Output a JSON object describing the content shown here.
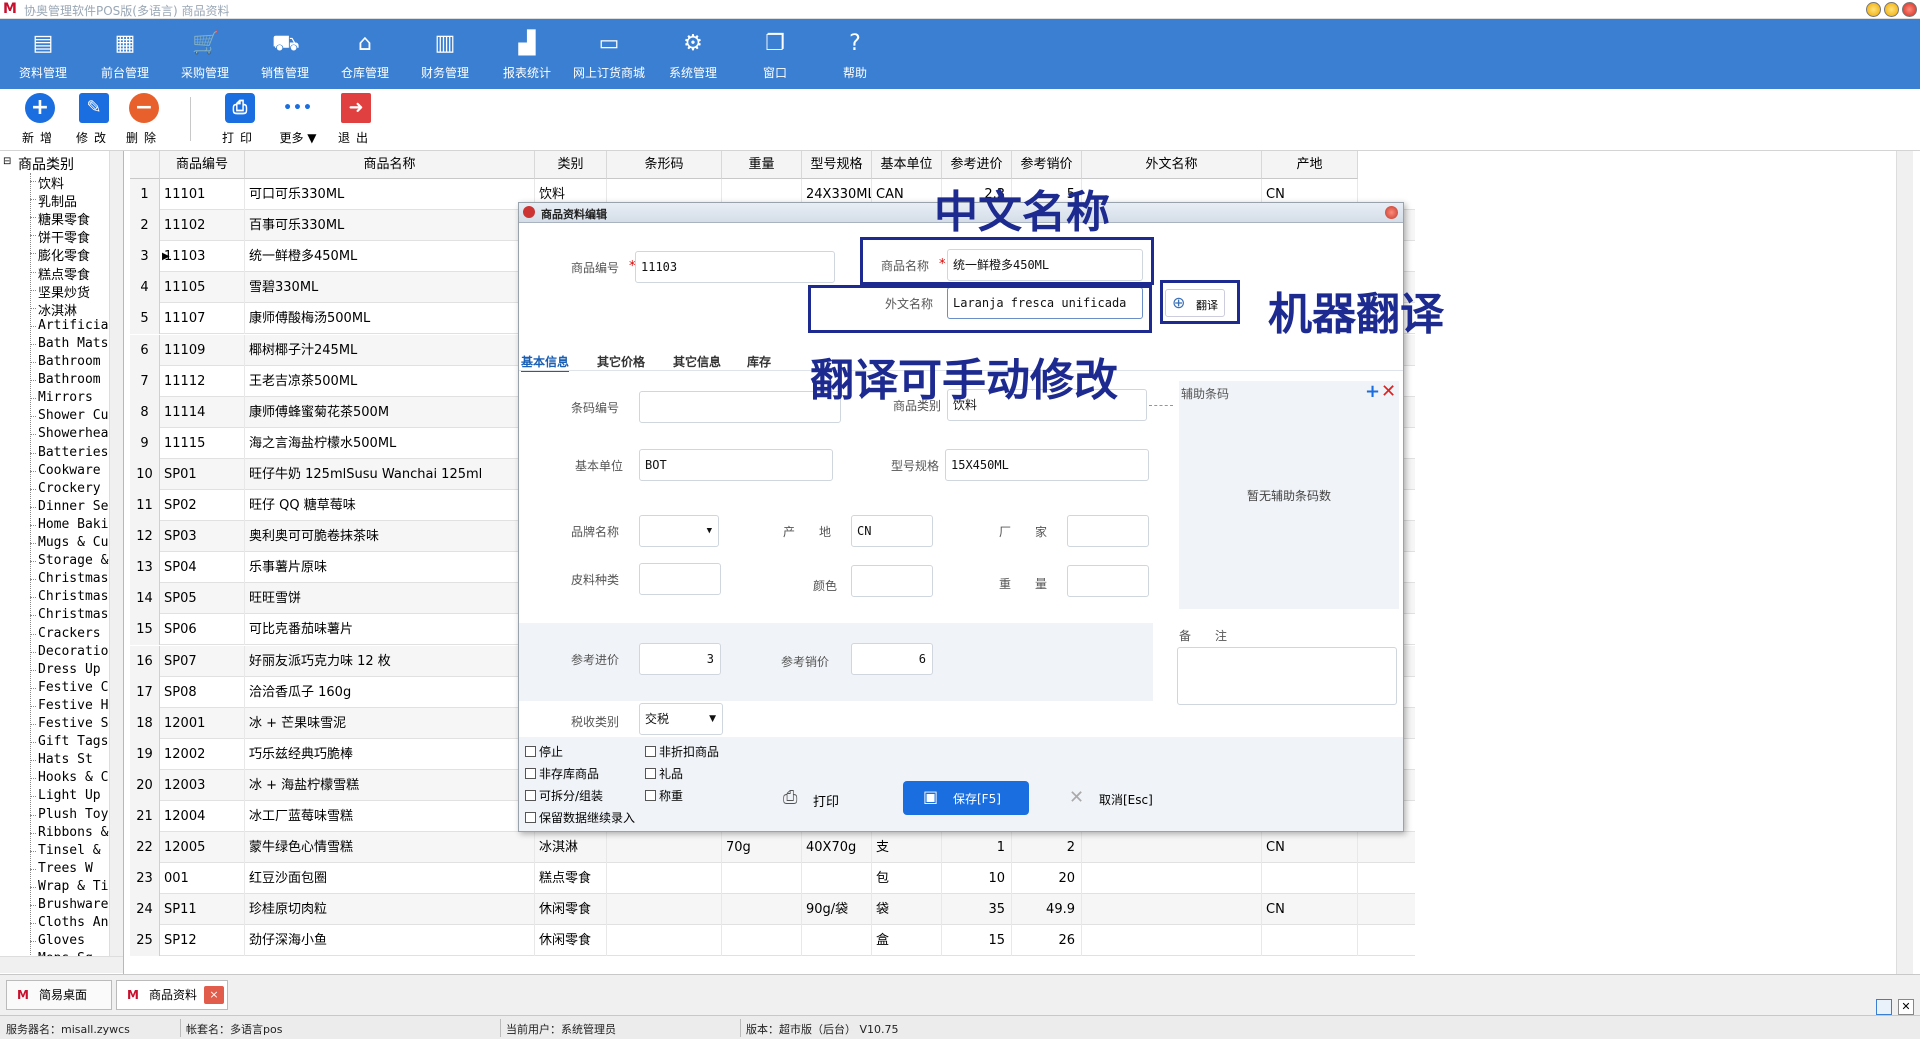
{
  "window": {
    "title": "协奥管理软件POS版(多语言) 商品资料",
    "logo": "M"
  },
  "menu": [
    {
      "label": "资料管理",
      "icon": "file-icon"
    },
    {
      "label": "前台管理",
      "icon": "cashier-icon"
    },
    {
      "label": "采购管理",
      "icon": "cart-icon"
    },
    {
      "label": "销售管理",
      "icon": "trolley-icon"
    },
    {
      "label": "仓库管理",
      "icon": "warehouse-icon"
    },
    {
      "label": "财务管理",
      "icon": "ledger-icon"
    },
    {
      "label": "报表统计",
      "icon": "chart-icon"
    },
    {
      "label": "网上订货商城",
      "icon": "store-icon"
    },
    {
      "label": "系统管理",
      "icon": "gear-icon"
    },
    {
      "label": "窗口",
      "icon": "window-icon"
    },
    {
      "label": "帮助",
      "icon": "help-icon"
    }
  ],
  "toolbar": {
    "add": "新增",
    "edit": "修改",
    "delete": "删除",
    "print": "打印",
    "more": "更多",
    "exit": "退出",
    "add_symbol": "+",
    "delete_symbol": "−",
    "more_symbol": "•••"
  },
  "tree": {
    "root": "商品类别",
    "items": [
      "饮料",
      "乳制品",
      "糖果零食",
      "饼干零食",
      "膨化零食",
      "糕点零食",
      "坚果炒货",
      "冰淇淋",
      "Artificia",
      "Bath Mats",
      "Bathroom",
      "Bathroom",
      "Mirrors",
      "Shower Cu",
      "Showerhea",
      "Batteries",
      "Cookware",
      "Crockery",
      "Dinner Se",
      "Home Baki",
      "Mugs & Cu",
      "Storage &",
      "Christmas",
      "Christmas",
      "Christmas",
      "Crackers",
      "Decoratio",
      "Dress Up",
      "Festive C",
      "Festive H",
      "Festive S",
      "Gift Tags",
      "Hats   St",
      "Hooks & C",
      "Light Up",
      "Plush Toy",
      "Ribbons &",
      "Tinsel &",
      "Trees    W",
      "Wrap & Ti",
      "Brushware",
      "Cloths An",
      "Gloves",
      "Mops  Sq"
    ]
  },
  "grid": {
    "columns": [
      "商品编号",
      "商品名称",
      "类别",
      "条形码",
      "重量",
      "型号规格",
      "基本单位",
      "参考进价",
      "参考销价",
      "外文名称",
      "产地"
    ],
    "rows": [
      {
        "n": "1",
        "code": "11101",
        "name": "可口可乐330ML",
        "cat": "饮料",
        "weight": "",
        "spec": "24X330ML",
        "unit": "CAN",
        "cost": "2.3",
        "price": "5",
        "origin": "CN"
      },
      {
        "n": "2",
        "code": "11102",
        "name": "百事可乐330ML",
        "cat": "",
        "weight": "",
        "spec": "",
        "unit": "",
        "cost": "",
        "price": "",
        "origin": ""
      },
      {
        "n": "3",
        "code": "11103",
        "name": "统一鲜橙多450ML",
        "cat": "",
        "weight": "",
        "spec": "",
        "unit": "",
        "cost": "",
        "price": "",
        "origin": "",
        "current": true
      },
      {
        "n": "4",
        "code": "11105",
        "name": "雪碧330ML",
        "cat": "",
        "weight": "",
        "spec": "",
        "unit": "",
        "cost": "",
        "price": "",
        "origin": ""
      },
      {
        "n": "5",
        "code": "11107",
        "name": "康师傅酸梅汤500ML",
        "cat": "",
        "weight": "",
        "spec": "",
        "unit": "",
        "cost": "",
        "price": "",
        "origin": ""
      },
      {
        "n": "6",
        "code": "11109",
        "name": "椰树椰子汁245ML",
        "cat": "",
        "weight": "",
        "spec": "",
        "unit": "",
        "cost": "",
        "price": "",
        "origin": ""
      },
      {
        "n": "7",
        "code": "11112",
        "name": "王老吉凉茶500ML",
        "cat": "",
        "weight": "",
        "spec": "",
        "unit": "",
        "cost": "",
        "price": "",
        "origin": ""
      },
      {
        "n": "8",
        "code": "11114",
        "name": "康师傅蜂蜜菊花茶500M",
        "cat": "",
        "weight": "",
        "spec": "",
        "unit": "",
        "cost": "",
        "price": "",
        "origin": ""
      },
      {
        "n": "9",
        "code": "11115",
        "name": "海之言海盐柠檬水500ML",
        "cat": "",
        "weight": "",
        "spec": "",
        "unit": "",
        "cost": "",
        "price": "",
        "origin": ""
      },
      {
        "n": "10",
        "code": "SP01",
        "name": "旺仔牛奶 125mlSusu Wanchai 125ml",
        "cat": "",
        "weight": "",
        "spec": "",
        "unit": "",
        "cost": "",
        "price": "",
        "origin": ""
      },
      {
        "n": "11",
        "code": "SP02",
        "name": "旺仔 QQ 糖草莓味",
        "cat": "",
        "weight": "",
        "spec": "",
        "unit": "",
        "cost": "",
        "price": "",
        "origin": ""
      },
      {
        "n": "12",
        "code": "SP03",
        "name": "奥利奥可可脆卷抹茶味",
        "cat": "",
        "weight": "",
        "spec": "",
        "unit": "",
        "cost": "",
        "price": "",
        "origin": ""
      },
      {
        "n": "13",
        "code": "SP04",
        "name": "乐事薯片原味",
        "cat": "",
        "weight": "",
        "spec": "",
        "unit": "",
        "cost": "",
        "price": "",
        "origin": ""
      },
      {
        "n": "14",
        "code": "SP05",
        "name": "旺旺雪饼",
        "cat": "",
        "weight": "",
        "spec": "",
        "unit": "",
        "cost": "",
        "price": "",
        "origin": ""
      },
      {
        "n": "15",
        "code": "SP06",
        "name": "可比克番茄味薯片",
        "cat": "",
        "weight": "",
        "spec": "",
        "unit": "",
        "cost": "",
        "price": "",
        "origin": ""
      },
      {
        "n": "16",
        "code": "SP07",
        "name": "好丽友派巧克力味 12 枚",
        "cat": "",
        "weight": "",
        "spec": "",
        "unit": "",
        "cost": "",
        "price": "",
        "origin": ""
      },
      {
        "n": "17",
        "code": "SP08",
        "name": "洽洽香瓜子 160g",
        "cat": "",
        "weight": "",
        "spec": "",
        "unit": "",
        "cost": "",
        "price": "",
        "origin": ""
      },
      {
        "n": "18",
        "code": "12001",
        "name": "冰 + 芒果味雪泥",
        "cat": "",
        "weight": "",
        "spec": "",
        "unit": "",
        "cost": "",
        "price": "",
        "origin": ""
      },
      {
        "n": "19",
        "code": "12002",
        "name": "巧乐兹经典巧脆棒",
        "cat": "",
        "weight": "",
        "spec": "",
        "unit": "",
        "cost": "",
        "price": "",
        "origin": ""
      },
      {
        "n": "20",
        "code": "12003",
        "name": "冰 + 海盐柠檬雪糕",
        "cat": "",
        "weight": "",
        "spec": "",
        "unit": "",
        "cost": "",
        "price": "",
        "origin": ""
      },
      {
        "n": "21",
        "code": "12004",
        "name": "冰工厂蓝莓味雪糕",
        "cat": "",
        "weight": "",
        "spec": "",
        "unit": "",
        "cost": "",
        "price": "",
        "origin": ""
      },
      {
        "n": "22",
        "code": "12005",
        "name": "蒙牛绿色心情雪糕",
        "cat": "冰淇淋",
        "weight": "70g",
        "spec": "40X70g",
        "unit": "支",
        "cost": "1",
        "price": "2",
        "origin": "CN"
      },
      {
        "n": "23",
        "code": "001",
        "name": "红豆沙面包圈",
        "cat": "糕点零食",
        "weight": "",
        "spec": "",
        "unit": "包",
        "cost": "10",
        "price": "20",
        "origin": ""
      },
      {
        "n": "24",
        "code": "SP11",
        "name": "珍桂原切肉粒",
        "cat": "休闲零食",
        "weight": "",
        "spec": "90g/袋",
        "unit": "袋",
        "cost": "35",
        "price": "49.9",
        "origin": "CN"
      },
      {
        "n": "25",
        "code": "SP12",
        "name": "劲仔深海小鱼",
        "cat": "休闲零食",
        "weight": "",
        "spec": "",
        "unit": "盒",
        "cost": "15",
        "price": "26",
        "origin": ""
      }
    ]
  },
  "dialog": {
    "title": "商品资料编辑",
    "code_label": "商品编号",
    "code_value": "11103",
    "name_label": "商品名称",
    "name_value": "统一鲜橙多450ML",
    "foreign_label": "外文名称",
    "foreign_value": "Laranja fresca unificada",
    "translate_label": "翻译",
    "tabs": [
      "基本信息",
      "其它价格",
      "其它信息",
      "库存"
    ],
    "barcode_label": "条码编号",
    "barcode_value": "",
    "category_label": "商品类别",
    "category_value": "饮料",
    "unit_label": "基本单位",
    "unit_value": "BOT",
    "spec_label": "型号规格",
    "spec_value": "15X450ML",
    "brand_label": "品牌名称",
    "origin_label": "产　　地",
    "origin_value": "CN",
    "maker_label": "厂　　家",
    "skin_label": "皮料种类",
    "color_label": "颜色",
    "weight_label": "重　　量",
    "cost_label": "参考进价",
    "cost_value": "3",
    "price_label": "参考销价",
    "price_value": "6",
    "tax_label": "税收类别",
    "tax_value": "交税",
    "aux_barcode_label": "辅助条码",
    "aux_barcode_empty": "暂无辅助条码数",
    "remark_label": "备　　注",
    "checkboxes": [
      "停止",
      "非折扣商品",
      "非存库商品",
      "礼品",
      "可拆分/组装",
      "称重",
      "保留数据继续录入"
    ],
    "print_btn": "打印",
    "save_btn": "保存[F5]",
    "cancel_btn": "取消[Esc]"
  },
  "annotations": {
    "chinese_name": "中文名称",
    "machine_translate": "机器翻译",
    "manual_edit": "翻译可手动修改",
    "color": "#1d2a8f"
  },
  "doc_tabs": {
    "desktop": "简易桌面",
    "goods": "商品资料"
  },
  "status": {
    "server": "服务器名：misall.zywcs",
    "account": "帐套名：多语言pos",
    "user": "当前用户：系统管理员",
    "version": "版本：超市版（后台） V10.75"
  },
  "colors": {
    "menubar": "#3a7fd2",
    "accent": "#1a6ee0",
    "danger": "#e8612c"
  }
}
